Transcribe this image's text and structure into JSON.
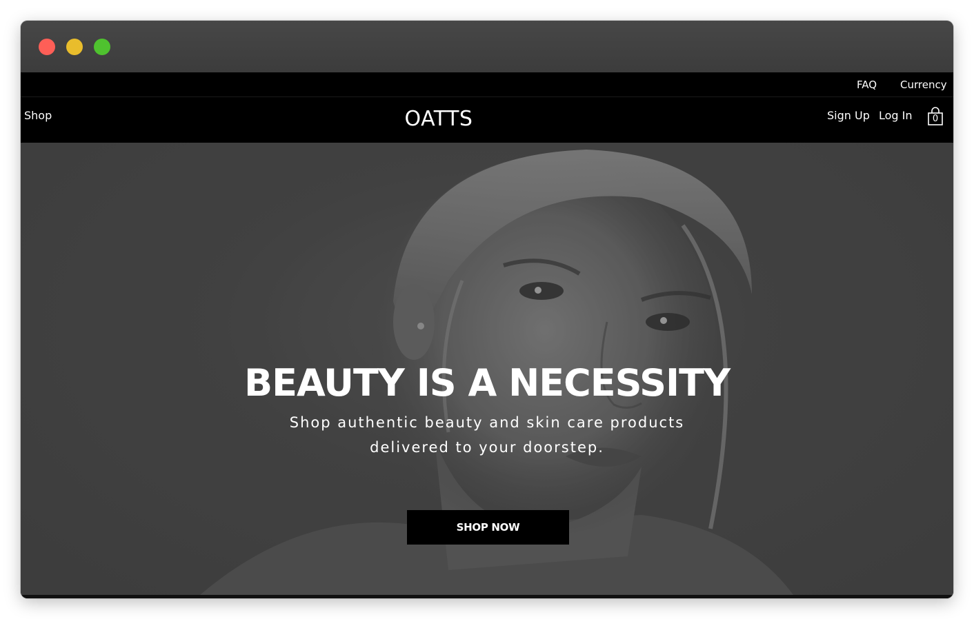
{
  "window": {
    "controls": [
      "close",
      "minimize",
      "maximize"
    ]
  },
  "topbar": {
    "faq": "FAQ",
    "currency": "Currency"
  },
  "nav": {
    "shop": "Shop",
    "logo": "OATTS",
    "sign_up": "Sign Up",
    "log_in": "Log In",
    "cart_icon": "shopping-bag-icon",
    "cart_count": "0"
  },
  "hero": {
    "title": "BEAUTY IS A NECESSITY",
    "subtitle": "Shop authentic beauty and skin care products delivered to your doorstep.",
    "cta": "SHOP NOW"
  },
  "colors": {
    "nav_bg": "#000000",
    "hero_overlay": "#4a4a4a",
    "text": "#ffffff",
    "close": "#fe5f57",
    "minimize": "#e9bd2c",
    "maximize": "#4fc22f"
  }
}
